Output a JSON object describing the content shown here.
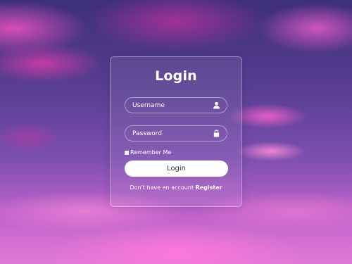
{
  "login_form": {
    "title": "Login",
    "username": {
      "value": "",
      "placeholder": "Username",
      "icon": "user-icon"
    },
    "password": {
      "value": "",
      "placeholder": "Password",
      "icon": "lock-icon"
    },
    "remember_me": {
      "label": "Remember Me",
      "checked": false
    },
    "submit_label": "Login",
    "register_prompt": "Don't have an account",
    "register_link": "Register"
  },
  "colors": {
    "text": "#ffffff",
    "button_bg": "#ffffff",
    "button_text": "#333333",
    "card_border": "rgba(255,255,255,0.35)"
  }
}
